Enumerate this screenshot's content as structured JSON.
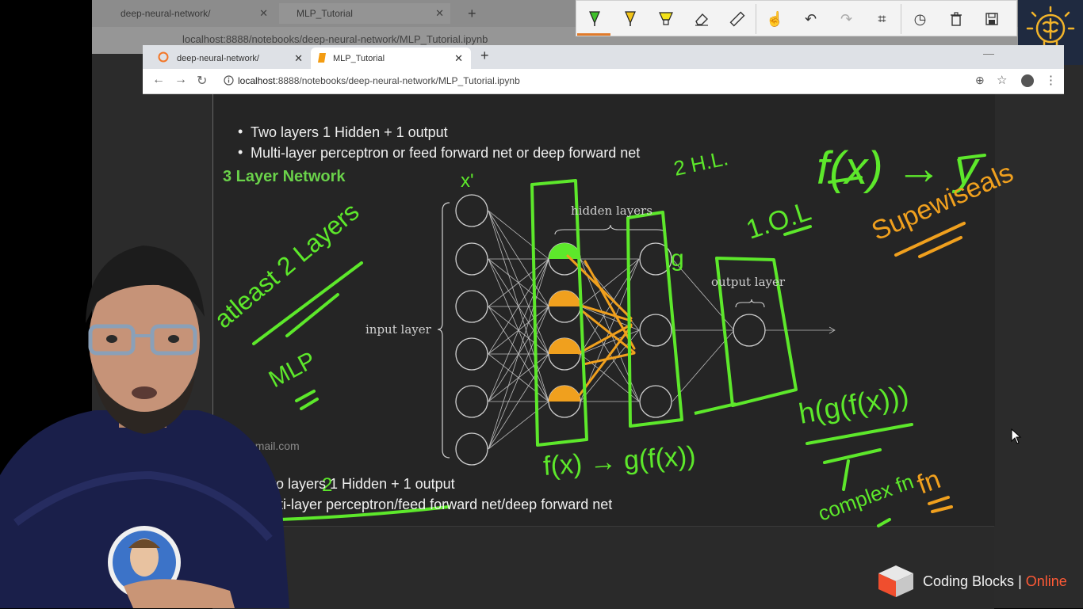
{
  "background_browser": {
    "tabs": [
      {
        "label": "deep-neural-network/"
      },
      {
        "label": "MLP_Tutorial"
      }
    ],
    "url": "localhost:8888/notebooks/deep-neural-network/MLP_Tutorial.ipynb"
  },
  "annotation_toolbar": {
    "tools": [
      "pen-icon",
      "highlighter-icon",
      "marker-icon",
      "eraser-icon",
      "ruler-icon",
      "touch-icon",
      "undo-icon",
      "redo-icon",
      "crop-icon",
      "history-icon",
      "trash-icon",
      "save-icon"
    ],
    "active_tool": "pen-icon",
    "accent": "#e07a2a"
  },
  "browser": {
    "tabs": [
      {
        "label": "deep-neural-network/",
        "icon": "jupyter-icon"
      },
      {
        "label": "MLP_Tutorial",
        "icon": "notebook-icon"
      }
    ],
    "active_tab": "MLP_Tutorial",
    "url_host": "localhost",
    "url_rest": ":8888/notebooks/deep-neural-network/MLP_Tutorial.ipynb"
  },
  "notebook": {
    "bullets_top": [
      "Two layers 1 Hidden + 1 output",
      "Multi-layer perceptron or feed forward net or deep forward net"
    ],
    "section_heading": "3 Layer Network",
    "diagram": {
      "hidden_layers_label": "hidden layers",
      "input_layer_label": "input layer",
      "output_layer_label": "output layer"
    },
    "bullets_bottom": [
      "Two layers 1 Hidden + 1 output",
      "Multi-layer perceptron/feed forward net/deep forward net"
    ],
    "bullets_bottom_visible": [
      "Two layers 1 Hidden + 1 output",
      "ulti-layer perceptron/feed forward net/deep forward net"
    ],
    "heading_color": "#6ad24a"
  },
  "handwriting": {
    "f_of_x_to_y": "f(x) → y",
    "two_hl": "2 H.L.",
    "one_ol": "1.O.L",
    "supervised": "Supewiseals",
    "g": "g",
    "x_prime": "x'",
    "atleast_2_layers": "atleast 2 Layers",
    "mlp": "MLP",
    "f_to_g": "f(x) → g(f(x))",
    "h_g_f": "h(g(f(x)))",
    "complex_fn": "complex fn",
    "two": "2",
    "colors": {
      "green": "#5de82b",
      "orange": "#f0a01e"
    }
  },
  "watermark": {
    "email": "azhad56@gmail.com"
  },
  "brand": {
    "name": "Coding Blocks",
    "suffix": "Online",
    "separator": "|",
    "accent": "#ff5a36"
  }
}
